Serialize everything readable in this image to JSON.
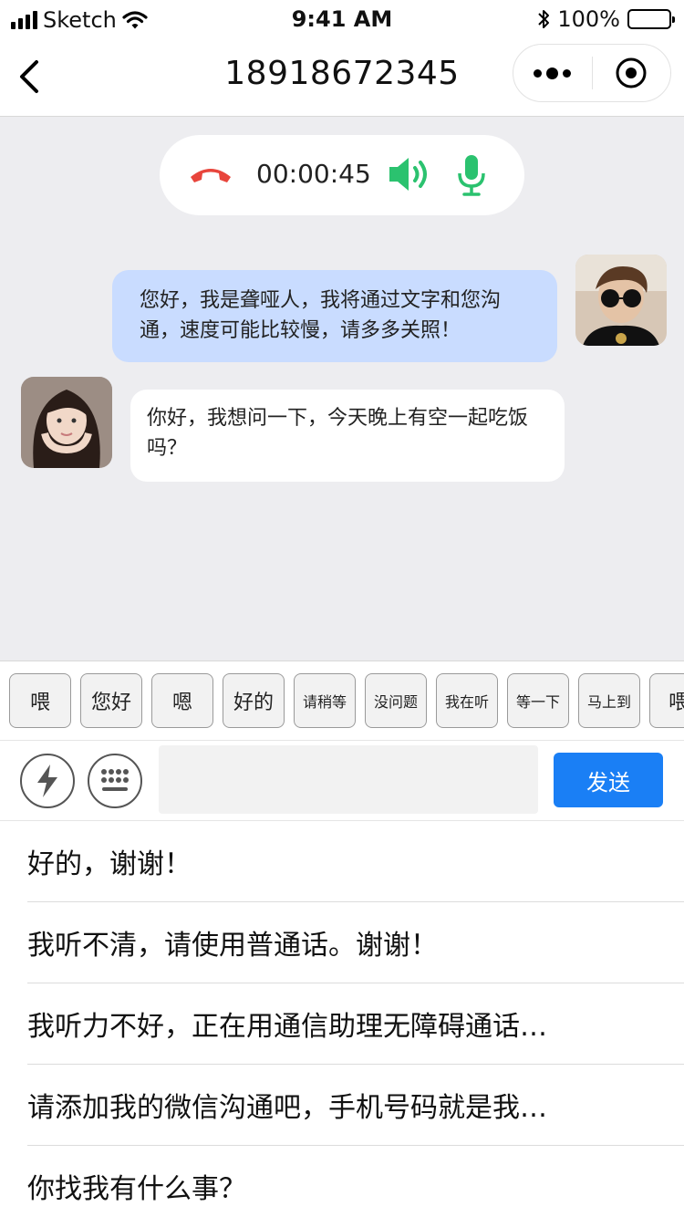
{
  "status_bar": {
    "carrier": "Sketch",
    "time": "9:41 AM",
    "battery": "100%"
  },
  "nav": {
    "title": "18918672345"
  },
  "call": {
    "duration": "00:00:45",
    "colors": {
      "hangup": "#e8453c",
      "active": "#2bc26f"
    }
  },
  "messages": [
    {
      "from": "me",
      "text": "您好，我是聋哑人，我将通过文字和您沟通，速度可能比较慢，请多多关照！"
    },
    {
      "from": "other",
      "text": "你好，我想问一下，今天晚上有空一起吃饭吗？"
    }
  ],
  "quick_phrases": [
    "喂",
    "您好",
    "嗯",
    "好的",
    "请稍等",
    "没问题",
    "我在听",
    "等一下",
    "马上到",
    "喂"
  ],
  "input": {
    "placeholder": "",
    "send_label": "发送"
  },
  "replies": [
    "好的，谢谢！",
    "我听不清，请使用普通话。谢谢！",
    "我听力不好，正在用通信助理无障碍通话…",
    "请添加我的微信沟通吧，手机号码就是我…",
    "你找我有什么事？"
  ],
  "accent_color": "#1a7ff5"
}
